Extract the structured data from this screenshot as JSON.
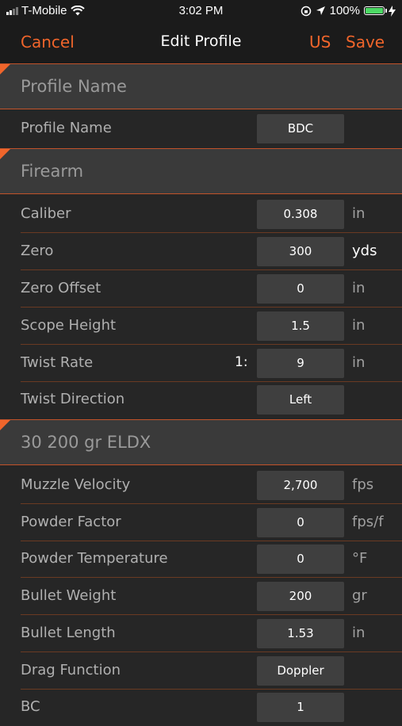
{
  "status": {
    "carrier": "T-Mobile",
    "time": "3:02 PM",
    "battery": "100%",
    "battery_level": 1.0
  },
  "nav": {
    "cancel": "Cancel",
    "title": "Edit Profile",
    "units": "US",
    "save": "Save"
  },
  "accent_color": "#f0652b",
  "sections": {
    "profile": {
      "title": "Profile Name",
      "rows": {
        "name": {
          "label": "Profile Name",
          "value": "BDC"
        }
      }
    },
    "firearm": {
      "title": "Firearm",
      "rows": {
        "caliber": {
          "label": "Caliber",
          "value": "0.308",
          "unit": "in"
        },
        "zero": {
          "label": "Zero",
          "value": "300",
          "unit": "yds"
        },
        "zero_offset": {
          "label": "Zero Offset",
          "value": "0",
          "unit": "in"
        },
        "scope_height": {
          "label": "Scope Height",
          "value": "1.5",
          "unit": "in"
        },
        "twist_rate": {
          "label": "Twist Rate",
          "prefix": "1:",
          "value": "9",
          "unit": "in"
        },
        "twist_direction": {
          "label": "Twist Direction",
          "value": "Left"
        }
      }
    },
    "ammo": {
      "title": "30 200 gr ELDX",
      "rows": {
        "muzzle_velocity": {
          "label": "Muzzle Velocity",
          "value": "2,700",
          "unit": "fps"
        },
        "powder_factor": {
          "label": "Powder Factor",
          "value": "0",
          "unit": "fps/f"
        },
        "powder_temperature": {
          "label": "Powder Temperature",
          "value": "0",
          "unit": "°F"
        },
        "bullet_weight": {
          "label": "Bullet Weight",
          "value": "200",
          "unit": "gr"
        },
        "bullet_length": {
          "label": "Bullet Length",
          "value": "1.53",
          "unit": "in"
        },
        "drag_function": {
          "label": "Drag Function",
          "value": "Doppler"
        },
        "bc": {
          "label": "BC",
          "value": "1"
        }
      }
    }
  }
}
